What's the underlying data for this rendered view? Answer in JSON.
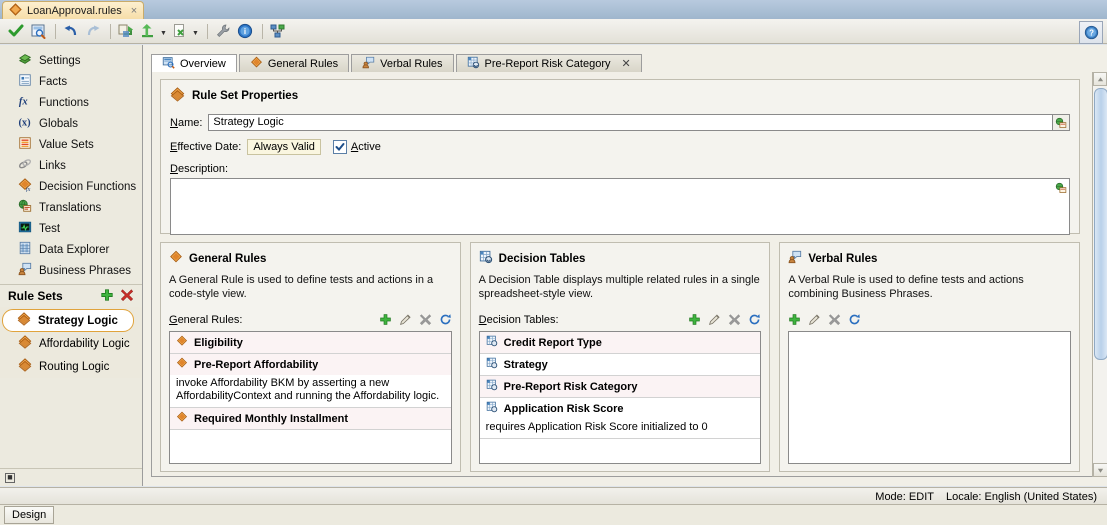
{
  "window": {
    "document_tab": "LoanApproval.rules",
    "close_label": "×"
  },
  "toolbar": {
    "items": [
      {
        "name": "validate-icon",
        "tip": "Validate"
      },
      {
        "name": "preview-icon",
        "tip": "Preview"
      },
      {
        "name": "undo-icon",
        "tip": "Undo"
      },
      {
        "name": "redo-icon",
        "tip": "Redo"
      },
      {
        "name": "apply-icon",
        "tip": "Apply"
      },
      {
        "name": "promote-icon",
        "tip": "Promote"
      },
      {
        "name": "export-icon",
        "tip": "Export"
      },
      {
        "name": "wrench-icon",
        "tip": "Tools"
      },
      {
        "name": "info-icon",
        "tip": "Info"
      },
      {
        "name": "diagram-icon",
        "tip": "Diagram"
      }
    ],
    "help_label": "?"
  },
  "sidebar": {
    "items": [
      {
        "label": "Settings",
        "icon": "settings-icon"
      },
      {
        "label": "Facts",
        "icon": "facts-icon"
      },
      {
        "label": "Functions",
        "icon": "functions-icon"
      },
      {
        "label": "Globals",
        "icon": "globals-icon"
      },
      {
        "label": "Value Sets",
        "icon": "value-sets-icon"
      },
      {
        "label": "Links",
        "icon": "links-icon"
      },
      {
        "label": "Decision Functions",
        "icon": "decision-functions-icon"
      },
      {
        "label": "Translations",
        "icon": "translations-icon"
      },
      {
        "label": "Test",
        "icon": "test-icon"
      },
      {
        "label": "Data Explorer",
        "icon": "data-explorer-icon"
      },
      {
        "label": "Business Phrases",
        "icon": "business-phrases-icon"
      }
    ],
    "rule_sets": {
      "title": "Rule Sets",
      "add_icon": "plus-icon",
      "delete_icon": "delete-x-icon",
      "items": [
        {
          "label": "Strategy Logic",
          "selected": true
        },
        {
          "label": "Affordability Logic",
          "selected": false
        },
        {
          "label": "Routing Logic",
          "selected": false
        }
      ]
    },
    "footer_glyph": "■"
  },
  "tabs": [
    {
      "label": "Overview",
      "icon": "overview-icon",
      "active": true,
      "closable": false
    },
    {
      "label": "General Rules",
      "icon": "general-rules-icon",
      "active": false,
      "closable": false
    },
    {
      "label": "Verbal Rules",
      "icon": "verbal-rules-icon",
      "active": false,
      "closable": false
    },
    {
      "label": "Pre-Report Risk Category",
      "icon": "decision-table-icon",
      "active": false,
      "closable": true,
      "close_label": "✕"
    }
  ],
  "rule_set_properties": {
    "title": "Rule Set Properties",
    "name_label": "Name:",
    "name_value": "Strategy Logic",
    "effective_date_label": "Effective Date:",
    "effective_date_value": "Always Valid",
    "active_label": "Active",
    "active_checked": true,
    "description_label": "Description:",
    "description_value": "",
    "description_placeholder": ""
  },
  "panels": [
    {
      "title": "General Rules",
      "icon": "general-rules-icon",
      "description": "A General Rule is used to define tests and actions in a code-style view.",
      "list_label": "General Rules:",
      "actions": [
        {
          "name": "add-icon",
          "label": "+"
        },
        {
          "name": "edit-pencil-icon",
          "label": "✎"
        },
        {
          "name": "delete-x-icon",
          "label": "✕"
        },
        {
          "name": "refresh-icon",
          "label": "↻"
        }
      ],
      "rows": [
        {
          "name": "Eligibility",
          "detail": ""
        },
        {
          "name": "Pre-Report Affordability",
          "detail": "invoke Affordability BKM by asserting a new AffordabilityContext and running the Affordability logic."
        },
        {
          "name": "Required Monthly Installment",
          "detail": ""
        }
      ]
    },
    {
      "title": "Decision Tables",
      "icon": "decision-table-icon",
      "description": "A Decision Table displays multiple related rules in a single spreadsheet-style view.",
      "list_label": "Decision Tables:",
      "actions": [
        {
          "name": "add-icon",
          "label": "+"
        },
        {
          "name": "edit-pencil-icon",
          "label": "✎"
        },
        {
          "name": "delete-x-icon",
          "label": "✕"
        },
        {
          "name": "refresh-icon",
          "label": "↻"
        }
      ],
      "rows": [
        {
          "name": "Credit Report Type",
          "detail": ""
        },
        {
          "name": "Strategy",
          "detail": ""
        },
        {
          "name": "Pre-Report Risk Category",
          "detail": ""
        },
        {
          "name": "Application Risk Score",
          "detail": "requires Application Risk Score initialized to 0"
        }
      ]
    },
    {
      "title": "Verbal Rules",
      "icon": "verbal-rules-icon",
      "description": "A Verbal Rule is used to define tests and actions combining Business Phrases.",
      "list_label": "",
      "actions": [
        {
          "name": "add-icon",
          "label": "+"
        },
        {
          "name": "edit-pencil-icon",
          "label": "✎"
        },
        {
          "name": "delete-x-icon",
          "label": "✕"
        },
        {
          "name": "refresh-icon",
          "label": "↻"
        }
      ],
      "rows": []
    }
  ],
  "status": {
    "mode": "Mode: EDIT",
    "locale": "Locale: English (United States)"
  },
  "bottom": {
    "design_tab": "Design"
  },
  "colors": {
    "accent_orange": "#e0852c",
    "selection_border": "#e0a33c",
    "panel_bg": "#f4f3ee",
    "row_header_bg": "#fbf3f4",
    "tab_active_bg": "#ffffff"
  }
}
